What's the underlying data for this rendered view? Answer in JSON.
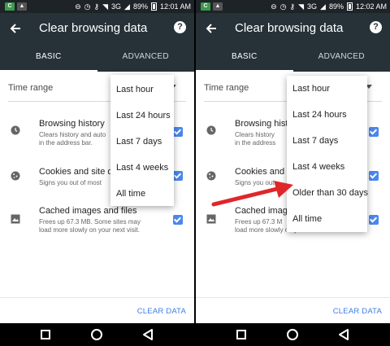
{
  "colors": {
    "toolbar": "#263238",
    "accent": "#4a87ee",
    "clear_button": "#3f7ee8",
    "annotation_arrow": "#e0262a"
  },
  "left": {
    "status": {
      "battery": "89%",
      "time": "12:01 AM",
      "network": "3G"
    },
    "toolbar": {
      "title": "Clear browsing data",
      "help_icon": "?"
    },
    "tabs": [
      "BASIC",
      "ADVANCED"
    ],
    "time_range_label": "Time range",
    "items": [
      {
        "title": "Browsing history",
        "subtitle_1": "Clears history and auto",
        "subtitle_2": "in the address bar."
      },
      {
        "title": "Cookies and site da",
        "subtitle_1": "Signs you out of most"
      },
      {
        "title": "Cached images and files",
        "subtitle_1": "Frees up 67.3 MB. Some sites may",
        "subtitle_2": "load more slowly on your next visit."
      }
    ],
    "dropdown": [
      "Last hour",
      "Last 24 hours",
      "Last 7 days",
      "Last 4 weeks",
      "All time"
    ],
    "clear_button": "CLEAR DATA"
  },
  "right": {
    "status": {
      "battery": "89%",
      "time": "12:02 AM",
      "network": "3G"
    },
    "toolbar": {
      "title": "Clear browsing data",
      "help_icon": "?"
    },
    "tabs": [
      "BASIC",
      "ADVANCED"
    ],
    "time_range_label": "Time range",
    "items": [
      {
        "title": "Browsing histo",
        "subtitle_1": "Clears history",
        "subtitle_2": "in the address"
      },
      {
        "title": "Cookies and s",
        "subtitle_1": "Signs you out"
      },
      {
        "title": "Cached imag",
        "subtitle_1": "Frees up 67.3 M",
        "subtitle_2": "load more slowly on your next visit."
      }
    ],
    "dropdown": [
      "Last hour",
      "Last 24 hours",
      "Last 7 days",
      "Last 4 weeks",
      "Older than 30 days",
      "All time"
    ],
    "clear_button": "CLEAR DATA"
  }
}
